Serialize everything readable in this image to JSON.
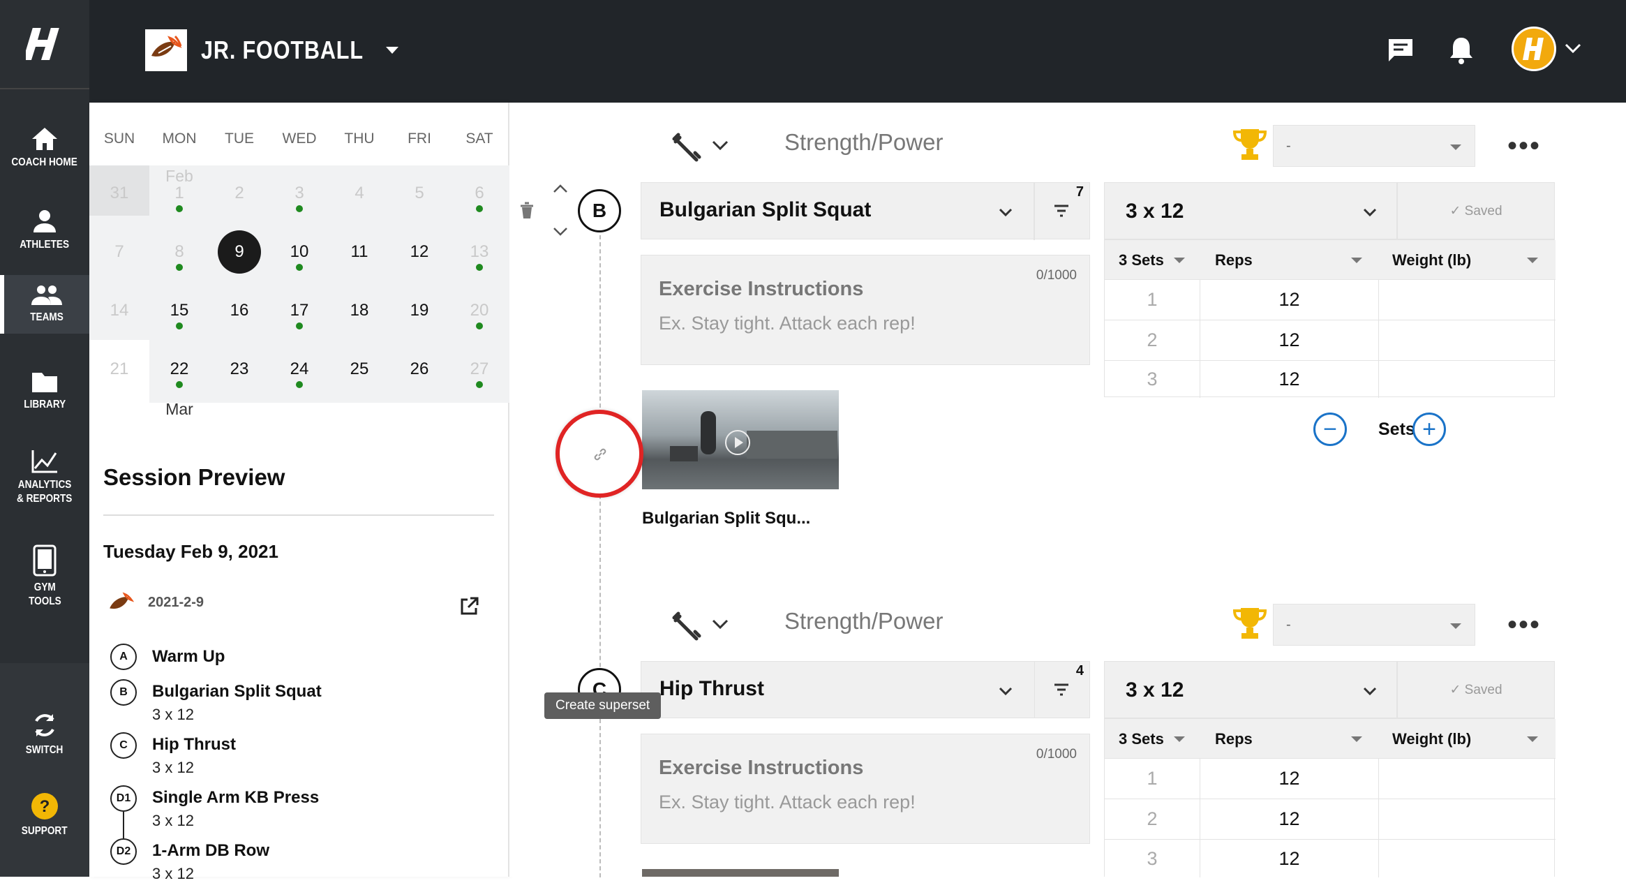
{
  "sidebar": {
    "items": [
      {
        "label": "COACH HOME",
        "icon": "home-icon"
      },
      {
        "label": "ATHLETES",
        "icon": "person-icon"
      },
      {
        "label": "TEAMS",
        "icon": "group-icon"
      },
      {
        "label": "LIBRARY",
        "icon": "folder-icon"
      },
      {
        "label_1": "ANALYTICS",
        "label_2": "& REPORTS",
        "icon": "chart-icon"
      },
      {
        "label_1": "GYM",
        "label_2": "TOOLS",
        "icon": "tablet-icon"
      },
      {
        "label": "SWITCH",
        "icon": "sync-icon"
      },
      {
        "label": "SUPPORT",
        "icon": "help-icon"
      }
    ]
  },
  "header": {
    "team_name": "JR. FOOTBALL"
  },
  "calendar": {
    "weekdays": [
      "SUN",
      "MON",
      "TUE",
      "WED",
      "THU",
      "FRI",
      "SAT"
    ],
    "feb_label": "Feb",
    "mar_label": "Mar",
    "week1": [
      "31",
      "1",
      "2",
      "3",
      "4",
      "5",
      "6"
    ],
    "week2": [
      "7",
      "8",
      "9",
      "10",
      "11",
      "12",
      "13"
    ],
    "week3": [
      "14",
      "15",
      "16",
      "17",
      "18",
      "19",
      "20"
    ],
    "week4": [
      "21",
      "22",
      "23",
      "24",
      "25",
      "26",
      "27"
    ]
  },
  "session_preview": {
    "title": "Session Preview",
    "date": "Tuesday Feb 9, 2021",
    "session_name": "2021-2-9",
    "exercises": [
      {
        "tag": "A",
        "name": "Warm Up",
        "sets": ""
      },
      {
        "tag": "B",
        "name": "Bulgarian Split Squat",
        "sets": "3 x 12"
      },
      {
        "tag": "C",
        "name": "Hip Thrust",
        "sets": "3 x 12"
      },
      {
        "tag": "D1",
        "name": "Single Arm KB Press",
        "sets": "3 x 12"
      },
      {
        "tag": "D2",
        "name": "1-Arm DB Row",
        "sets": "3 x 12"
      }
    ]
  },
  "blocks": [
    {
      "category": "Strength/Power",
      "trophy_select": "-",
      "tag": "B",
      "exercise": "Bulgarian Split Squat",
      "filter_count": "7",
      "instructions_title": "Exercise Instructions",
      "instructions_placeholder": "Ex. Stay tight. Attack each rep!",
      "char_count": "0/1000",
      "scheme": "3 x 12",
      "saved": "✓ Saved",
      "col_sets": "3 Sets",
      "col_reps": "Reps",
      "col_weight": "Weight (lb)",
      "rows": [
        {
          "n": "1",
          "reps": "12"
        },
        {
          "n": "2",
          "reps": "12"
        },
        {
          "n": "3",
          "reps": "12"
        }
      ],
      "sets_label": "Sets",
      "video_caption": "Bulgarian Split Squ..."
    },
    {
      "category": "Strength/Power",
      "trophy_select": "-",
      "tag": "C",
      "exercise": "Hip Thrust",
      "filter_count": "4",
      "instructions_title": "Exercise Instructions",
      "instructions_placeholder": "Ex. Stay tight. Attack each rep!",
      "char_count": "0/1000",
      "scheme": "3 x 12",
      "saved": "✓ Saved",
      "col_sets": "3 Sets",
      "col_reps": "Reps",
      "col_weight": "Weight (lb)",
      "rows": [
        {
          "n": "1",
          "reps": "12"
        },
        {
          "n": "2",
          "reps": "12"
        },
        {
          "n": "3",
          "reps": "12"
        }
      ]
    }
  ],
  "tooltip": "Create superset",
  "colors": {
    "accent": "#1a73c8",
    "highlight_ring": "#e02424",
    "dot": "#1f8a1f",
    "trophy": "#f2b705"
  }
}
